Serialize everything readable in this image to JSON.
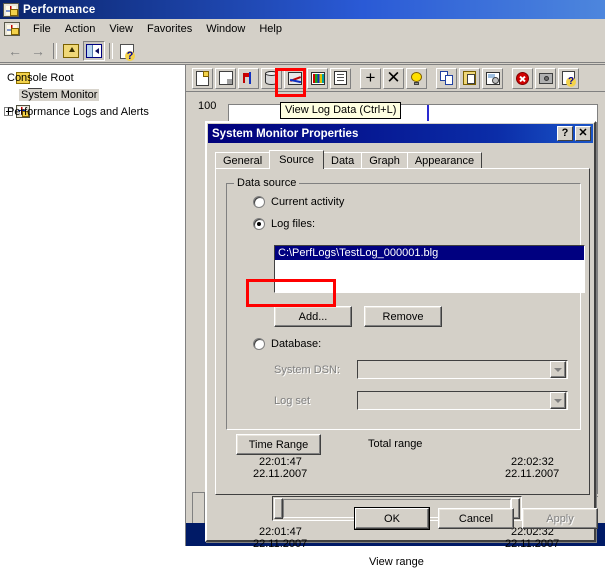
{
  "window": {
    "title": "Performance",
    "icon": "performance-icon"
  },
  "menubar": {
    "items": [
      {
        "label": "File"
      },
      {
        "label": "Action"
      },
      {
        "label": "View"
      },
      {
        "label": "Favorites"
      },
      {
        "label": "Window"
      },
      {
        "label": "Help"
      }
    ]
  },
  "console_toolbar": {
    "buttons": [
      {
        "name": "back-arrow-icon"
      },
      {
        "name": "forward-arrow-icon"
      },
      {
        "name": "up-one-level-icon"
      },
      {
        "name": "show-hide-console-tree-icon"
      },
      {
        "name": "help-icon"
      }
    ]
  },
  "tree": {
    "items": [
      {
        "label": "Console Root",
        "icon": "folder-icon",
        "level": 0,
        "selected": false,
        "expander": false
      },
      {
        "label": "System Monitor",
        "icon": "system-monitor-icon",
        "level": 1,
        "selected": true,
        "expander": false
      },
      {
        "label": "Performance Logs and Alerts",
        "icon": "performance-logs-icon",
        "level": 0,
        "selected": false,
        "expander": true
      }
    ]
  },
  "graph_toolbar": {
    "buttons": [
      {
        "name": "new-counter-set-icon",
        "tip": "New Counter Set"
      },
      {
        "name": "clear-display-icon",
        "tip": "Clear Display"
      },
      {
        "name": "view-current-activity-icon",
        "tip": "View Current Activity"
      },
      {
        "name": "view-log-data-icon",
        "tip": "View Log Data (Ctrl+L)",
        "highlighted": true
      },
      {
        "name": "view-chart-icon",
        "tip": "View Chart"
      },
      {
        "name": "view-histogram-icon",
        "tip": "View Histogram"
      },
      {
        "name": "view-report-icon",
        "tip": "View Report"
      },
      {
        "name": "add-counter-icon",
        "tip": "Add"
      },
      {
        "name": "delete-counter-icon",
        "tip": "Delete"
      },
      {
        "name": "highlight-icon",
        "tip": "Highlight"
      },
      {
        "name": "copy-properties-icon",
        "tip": "Copy Properties"
      },
      {
        "name": "paste-counter-list-icon",
        "tip": "Paste Counter List"
      },
      {
        "name": "properties-icon",
        "tip": "Properties"
      },
      {
        "name": "freeze-display-icon",
        "tip": "Freeze Display"
      },
      {
        "name": "update-data-icon",
        "tip": "Update Data"
      },
      {
        "name": "help-icon",
        "tip": "Help"
      }
    ]
  },
  "tooltip": {
    "text": "View Log Data (Ctrl+L)"
  },
  "chart": {
    "y_axis_top_label": "100"
  },
  "dialog": {
    "title": "System Monitor Properties",
    "help_button": "?",
    "close_button": "✕",
    "tabs": [
      {
        "label": "General",
        "active": false
      },
      {
        "label": "Source",
        "active": true
      },
      {
        "label": "Data",
        "active": false
      },
      {
        "label": "Graph",
        "active": false
      },
      {
        "label": "Appearance",
        "active": false
      }
    ],
    "data_source": {
      "group_title": "Data source",
      "options": [
        {
          "label": "Current activity",
          "checked": false
        },
        {
          "label": "Log files:",
          "checked": true
        },
        {
          "label": "Database:",
          "checked": false
        }
      ],
      "log_files": [
        "C:\\PerfLogs\\TestLog_000001.blg"
      ],
      "add_button": "Add...",
      "remove_button": "Remove",
      "system_dsn_label": "System DSN:",
      "system_dsn_value": "",
      "log_set_label": "Log set",
      "log_set_value": ""
    },
    "time_range": {
      "button_label": "Time Range",
      "total_range_label": "Total range",
      "view_range_label": "View range",
      "total_start_time": "22:01:47",
      "total_start_date": "22.11.2007",
      "total_end_time": "22:02:32",
      "total_end_date": "22.11.2007",
      "view_start_time": "22:01:47",
      "view_start_date": "22.11.2007",
      "view_end_time": "22:02:32",
      "view_end_date": "22.11.2007"
    },
    "footer": {
      "ok": "OK",
      "cancel": "Cancel",
      "apply": "Apply",
      "apply_disabled": true
    }
  },
  "highlights": {
    "color": "#ff0000",
    "targets": [
      "view-log-data-toolbar-button",
      "add-button"
    ]
  }
}
